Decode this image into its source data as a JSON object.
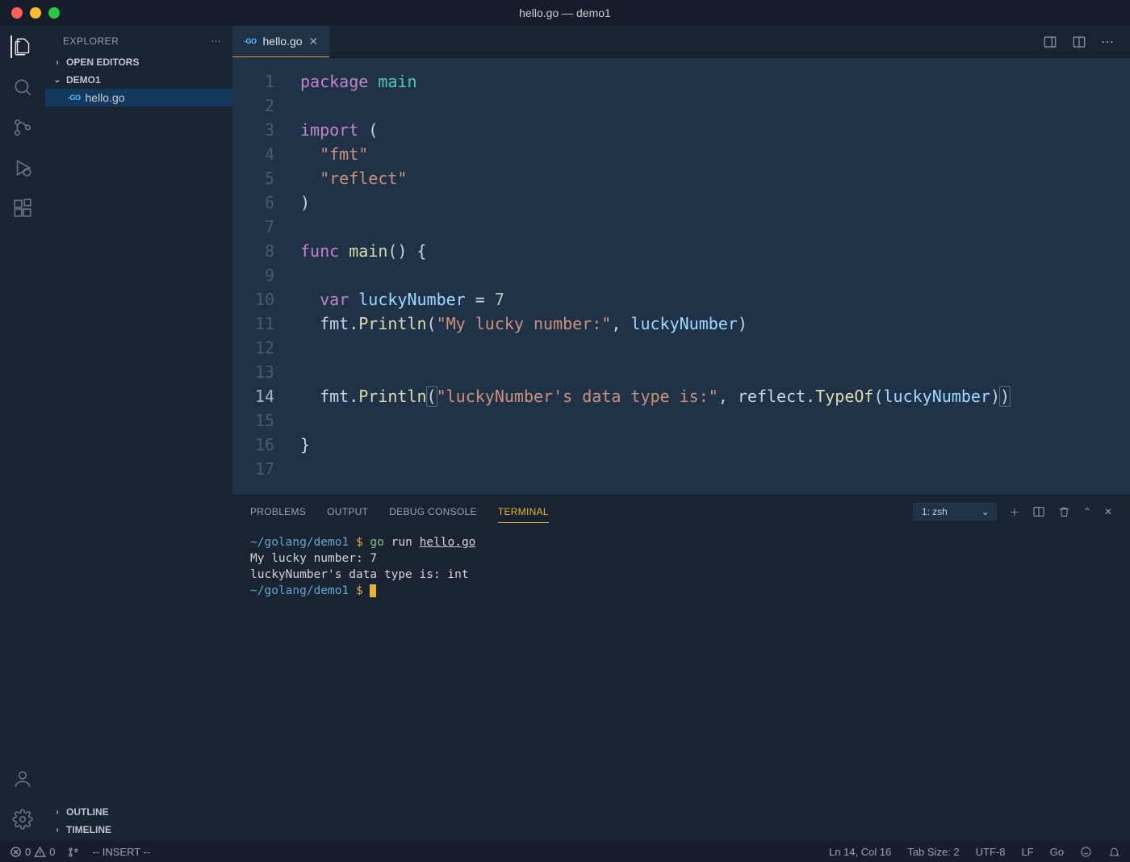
{
  "window": {
    "title": "hello.go — demo1"
  },
  "sidebar": {
    "title": "EXPLORER",
    "openEditors": "OPEN EDITORS",
    "project": "DEMO1",
    "file": "hello.go",
    "outline": "OUTLINE",
    "timeline": "TIMELINE"
  },
  "tab": {
    "filename": "hello.go"
  },
  "code": {
    "lines": [
      {
        "n": "1",
        "seg": [
          {
            "t": "package ",
            "c": "kw"
          },
          {
            "t": "main",
            "c": "pkg"
          }
        ]
      },
      {
        "n": "2",
        "seg": []
      },
      {
        "n": "3",
        "seg": [
          {
            "t": "import ",
            "c": "kw"
          },
          {
            "t": "(",
            "c": ""
          }
        ]
      },
      {
        "n": "4",
        "seg": [
          {
            "t": "  ",
            "c": ""
          },
          {
            "t": "\"fmt\"",
            "c": "str"
          }
        ]
      },
      {
        "n": "5",
        "seg": [
          {
            "t": "  ",
            "c": ""
          },
          {
            "t": "\"reflect\"",
            "c": "str"
          }
        ]
      },
      {
        "n": "6",
        "seg": [
          {
            "t": ")",
            "c": ""
          }
        ]
      },
      {
        "n": "7",
        "seg": []
      },
      {
        "n": "8",
        "seg": [
          {
            "t": "func ",
            "c": "kw"
          },
          {
            "t": "main",
            "c": "fn"
          },
          {
            "t": "() {",
            "c": ""
          }
        ]
      },
      {
        "n": "9",
        "seg": [
          {
            "t": "  ",
            "c": ""
          }
        ]
      },
      {
        "n": "10",
        "seg": [
          {
            "t": "  ",
            "c": ""
          },
          {
            "t": "var ",
            "c": "kw"
          },
          {
            "t": "luckyNumber",
            "c": "var"
          },
          {
            "t": " = ",
            "c": ""
          },
          {
            "t": "7",
            "c": "num"
          }
        ]
      },
      {
        "n": "11",
        "seg": [
          {
            "t": "  fmt.",
            "c": ""
          },
          {
            "t": "Println",
            "c": "fn"
          },
          {
            "t": "(",
            "c": ""
          },
          {
            "t": "\"My lucky number:\"",
            "c": "str"
          },
          {
            "t": ", ",
            "c": ""
          },
          {
            "t": "luckyNumber",
            "c": "var"
          },
          {
            "t": ")",
            "c": ""
          }
        ]
      },
      {
        "n": "12",
        "seg": [
          {
            "t": "  ",
            "c": ""
          }
        ]
      },
      {
        "n": "13",
        "seg": [
          {
            "t": "  ",
            "c": ""
          }
        ]
      },
      {
        "n": "14",
        "cur": true,
        "seg": [
          {
            "t": "  fmt.",
            "c": ""
          },
          {
            "t": "Println",
            "c": "fn"
          },
          {
            "t": "(",
            "c": "hlbox"
          },
          {
            "t": "\"luckyNumber's data type is:\"",
            "c": "str"
          },
          {
            "t": ", reflect.",
            "c": ""
          },
          {
            "t": "TypeOf",
            "c": "fn"
          },
          {
            "t": "(",
            "c": ""
          },
          {
            "t": "luckyNumber",
            "c": "var"
          },
          {
            "t": ")",
            "c": ""
          },
          {
            "t": ")",
            "c": "hlbox"
          }
        ]
      },
      {
        "n": "15",
        "seg": [
          {
            "t": "  ",
            "c": ""
          }
        ]
      },
      {
        "n": "16",
        "seg": [
          {
            "t": "}",
            "c": ""
          }
        ]
      },
      {
        "n": "17",
        "seg": []
      }
    ]
  },
  "panel": {
    "tabs": [
      "PROBLEMS",
      "OUTPUT",
      "DEBUG CONSOLE",
      "TERMINAL"
    ],
    "activeTab": "TERMINAL",
    "selector": "1: zsh",
    "terminal": {
      "path": "~/golang/demo1",
      "cmd_go": "go",
      "cmd_run": "run",
      "cmd_file": "hello.go",
      "out1": "My lucky number: 7",
      "out2": "luckyNumber's data type is: int"
    }
  },
  "status": {
    "errors": "0",
    "warnings": "0",
    "mode": "-- INSERT --",
    "line": "Ln 14, Col 16",
    "tab": "Tab Size: 2",
    "enc": "UTF-8",
    "eol": "LF",
    "lang": "Go"
  }
}
